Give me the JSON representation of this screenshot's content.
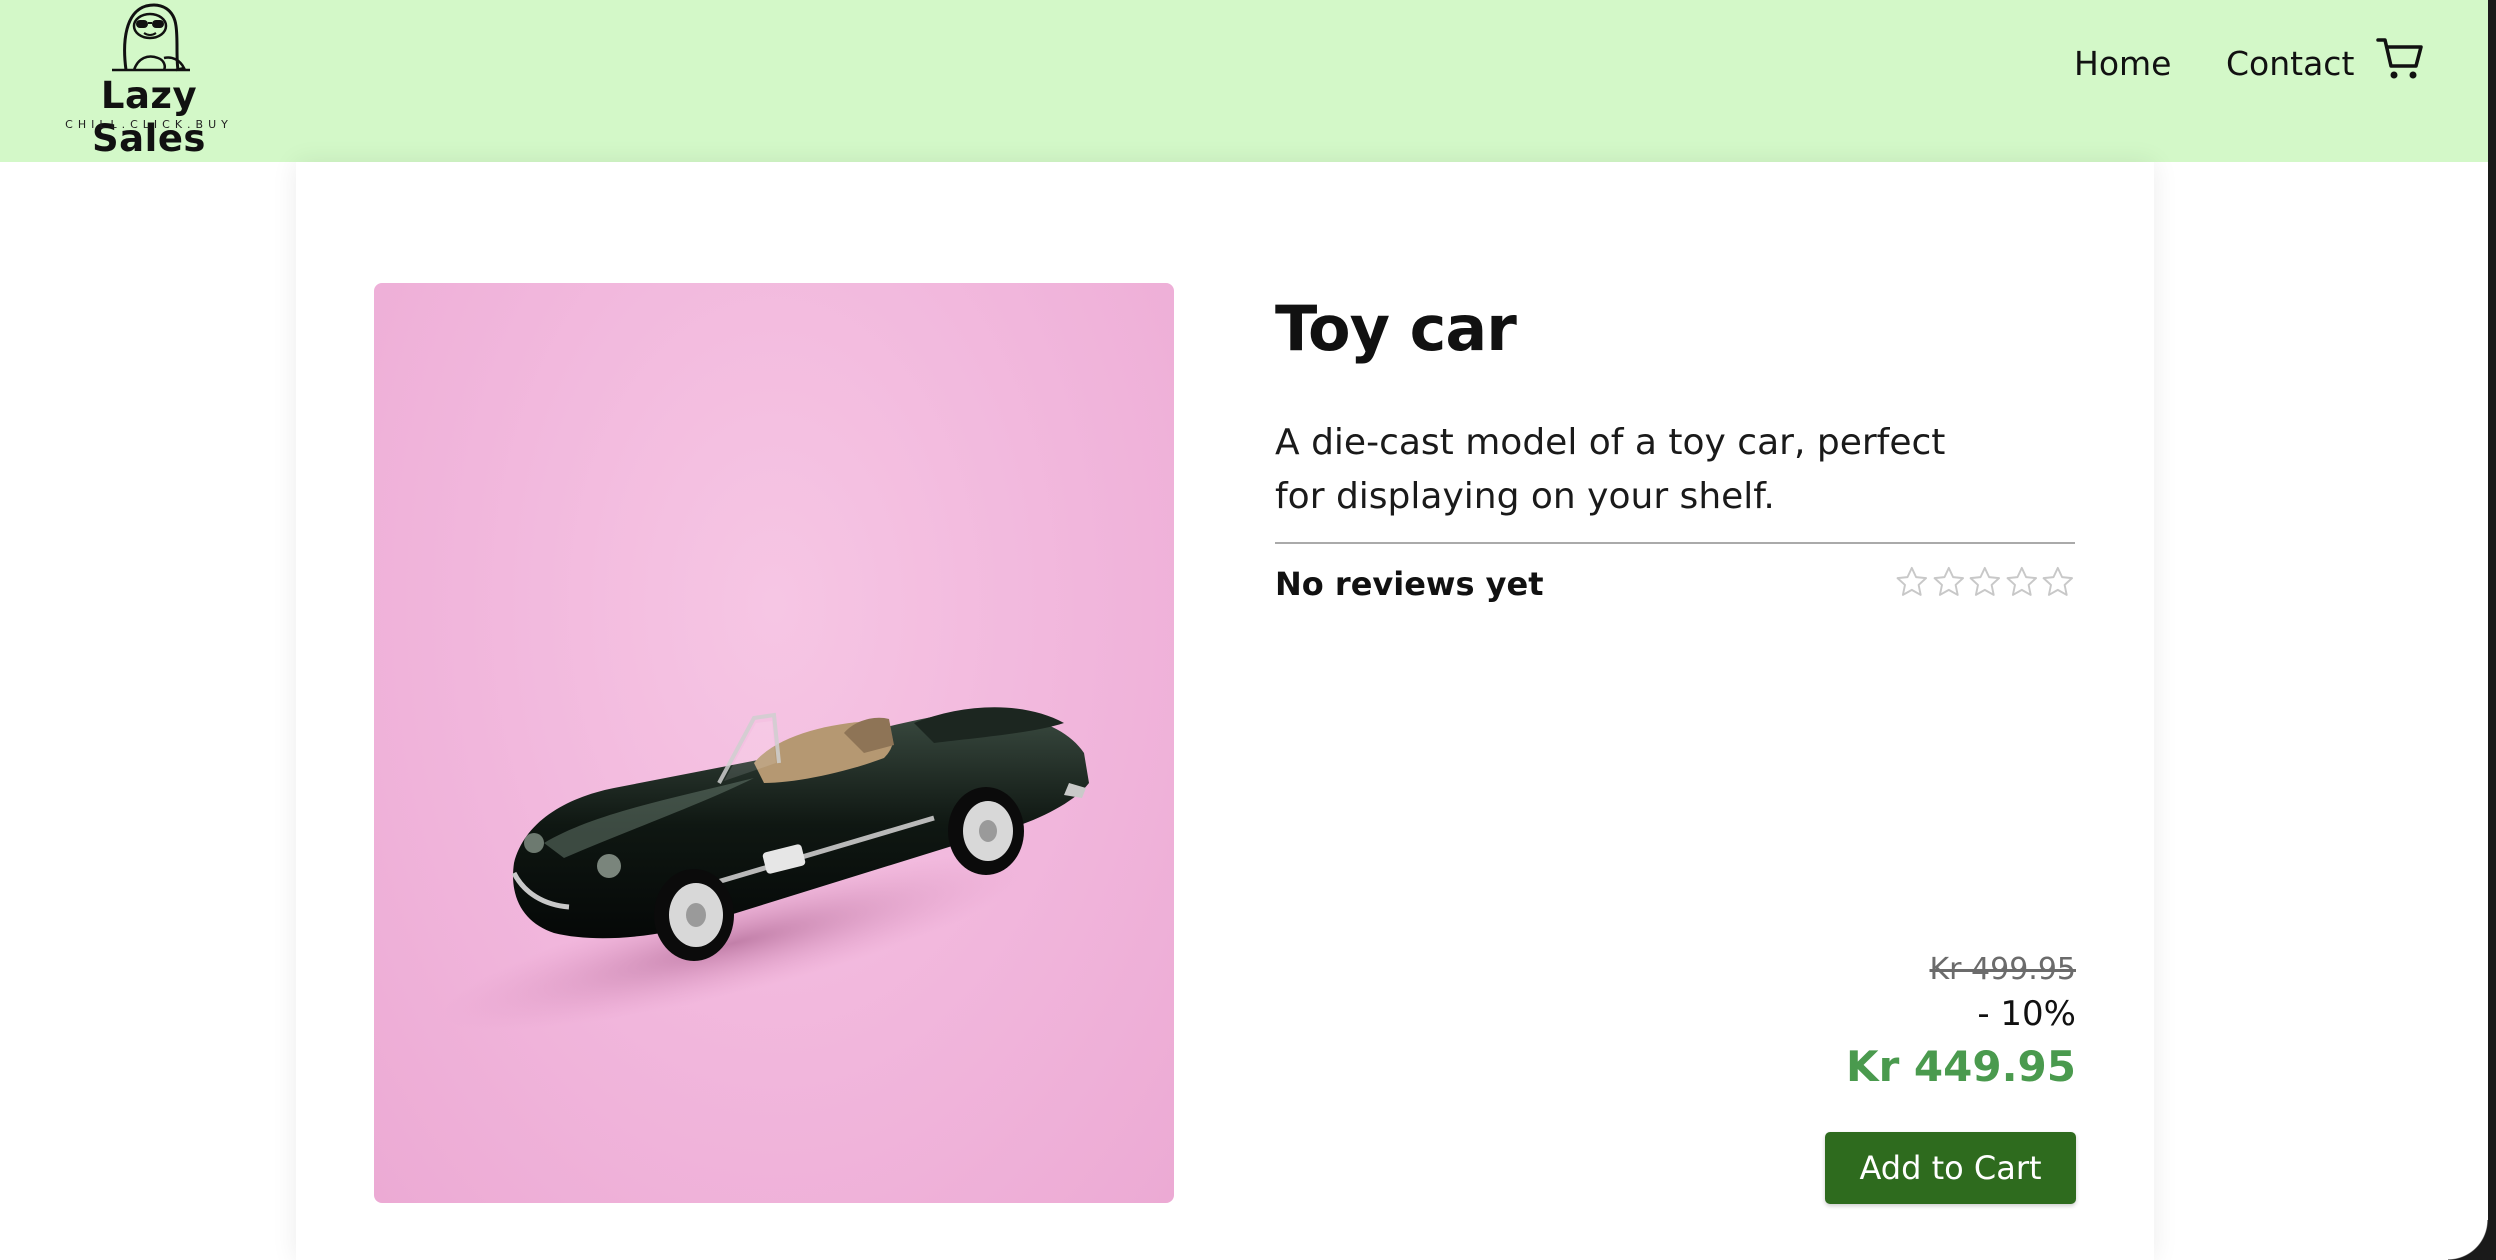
{
  "header": {
    "logo_name": "Lazy Sales",
    "logo_tagline": "CHILL.CLICK.BUY",
    "nav": [
      {
        "label": "Home"
      },
      {
        "label": "Contact"
      }
    ],
    "cart_icon": "cart-icon",
    "background_color": "#d3f8c8"
  },
  "product": {
    "title": "Toy car",
    "description": "A die-cast model of a toy car, perfect for displaying on your shelf.",
    "reviews_label": "No reviews yet",
    "rating": 0,
    "rating_max": 5,
    "original_price": "Kr 499.95",
    "discount": "- 10%",
    "current_price": "Kr 449.95",
    "add_to_cart_label": "Add to Cart",
    "image_subject": "black convertible toy car on pink background"
  },
  "colors": {
    "accent_button": "#2e6b1e",
    "price_green": "#4a9a4e",
    "image_background": "#f1b6dc"
  }
}
